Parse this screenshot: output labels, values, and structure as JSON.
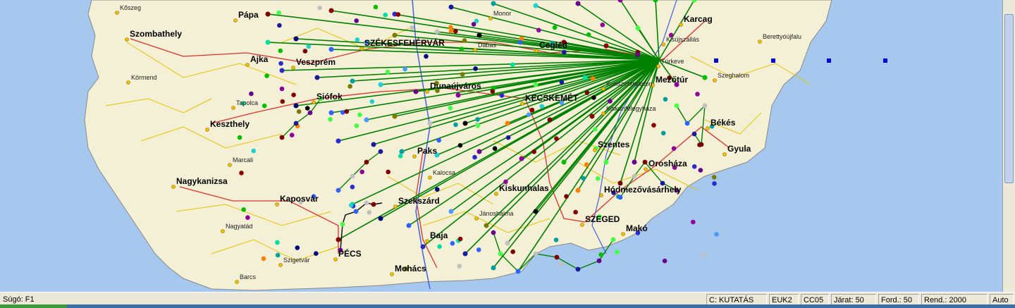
{
  "map": {
    "colors": {
      "sea": "#a6c8ee",
      "land": "#f4f0d6",
      "route_main": "#008000",
      "road_major": "#e0302a",
      "road_minor": "#e8c000",
      "river": "#4060e0"
    },
    "hub_label": "Túrkeve",
    "cities": [
      {
        "name": "Kőszeg",
        "size": "small"
      },
      {
        "name": "Pápa",
        "size": "big"
      },
      {
        "name": "Szombathely",
        "size": "big"
      },
      {
        "name": "Körmend",
        "size": "small"
      },
      {
        "name": "Ajka",
        "size": "big"
      },
      {
        "name": "Veszprém",
        "size": "big"
      },
      {
        "name": "SZÉKESFEHÉRVÁR",
        "size": "big"
      },
      {
        "name": "Dabas",
        "size": "small"
      },
      {
        "name": "Cegléd",
        "size": "big"
      },
      {
        "name": "Monor",
        "size": "small"
      },
      {
        "name": "Tapolca",
        "size": "small"
      },
      {
        "name": "Siófok",
        "size": "big"
      },
      {
        "name": "Dunaújváros",
        "size": "big"
      },
      {
        "name": "KECSKEMÉT",
        "size": "big"
      },
      {
        "name": "Keszthely",
        "size": "big"
      },
      {
        "name": "Kiskunfélegyháza",
        "size": "small"
      },
      {
        "name": "Paks",
        "size": "big"
      },
      {
        "name": "Szentes",
        "size": "big"
      },
      {
        "name": "Marcali",
        "size": "small"
      },
      {
        "name": "Kalocsa",
        "size": "small"
      },
      {
        "name": "Nagykanizsa",
        "size": "big"
      },
      {
        "name": "Kiskunhalas",
        "size": "big"
      },
      {
        "name": "Kaposvár",
        "size": "big"
      },
      {
        "name": "Szekszárd",
        "size": "big"
      },
      {
        "name": "Hódmezővásárhely",
        "size": "big"
      },
      {
        "name": "Orosháza",
        "size": "big"
      },
      {
        "name": "Nagyatád",
        "size": "small"
      },
      {
        "name": "Jánoshalma",
        "size": "small"
      },
      {
        "name": "SZEGED",
        "size": "big"
      },
      {
        "name": "Makó",
        "size": "big"
      },
      {
        "name": "Baja",
        "size": "big"
      },
      {
        "name": "PÉCS",
        "size": "big"
      },
      {
        "name": "Szigetvár",
        "size": "small"
      },
      {
        "name": "Mohács",
        "size": "big"
      },
      {
        "name": "Barcs",
        "size": "small"
      },
      {
        "name": "Karcag",
        "size": "big"
      },
      {
        "name": "Berettyóújfalu",
        "size": "small"
      },
      {
        "name": "Kisújszállás",
        "size": "small"
      },
      {
        "name": "Túrkeve",
        "size": "small"
      },
      {
        "name": "Szeghalom",
        "size": "small"
      },
      {
        "name": "Mezőtúr",
        "size": "big"
      },
      {
        "name": "Kunszentmárton",
        "size": "small"
      },
      {
        "name": "Békés",
        "size": "big"
      },
      {
        "name": "Gyula",
        "size": "big"
      }
    ]
  },
  "status_bar": {
    "help": "Súgó: F1",
    "panels": [
      {
        "id": "mode",
        "text": "C:  KUTATÁS"
      },
      {
        "id": "euk",
        "text": "EUK2"
      },
      {
        "id": "cc",
        "text": "CC05"
      },
      {
        "id": "jarat",
        "text": "Járat:  50"
      },
      {
        "id": "ford",
        "text": "Ford.:   50"
      },
      {
        "id": "rend",
        "text": "Rend.: 2000"
      },
      {
        "id": "auto",
        "text": "Auto"
      }
    ]
  }
}
